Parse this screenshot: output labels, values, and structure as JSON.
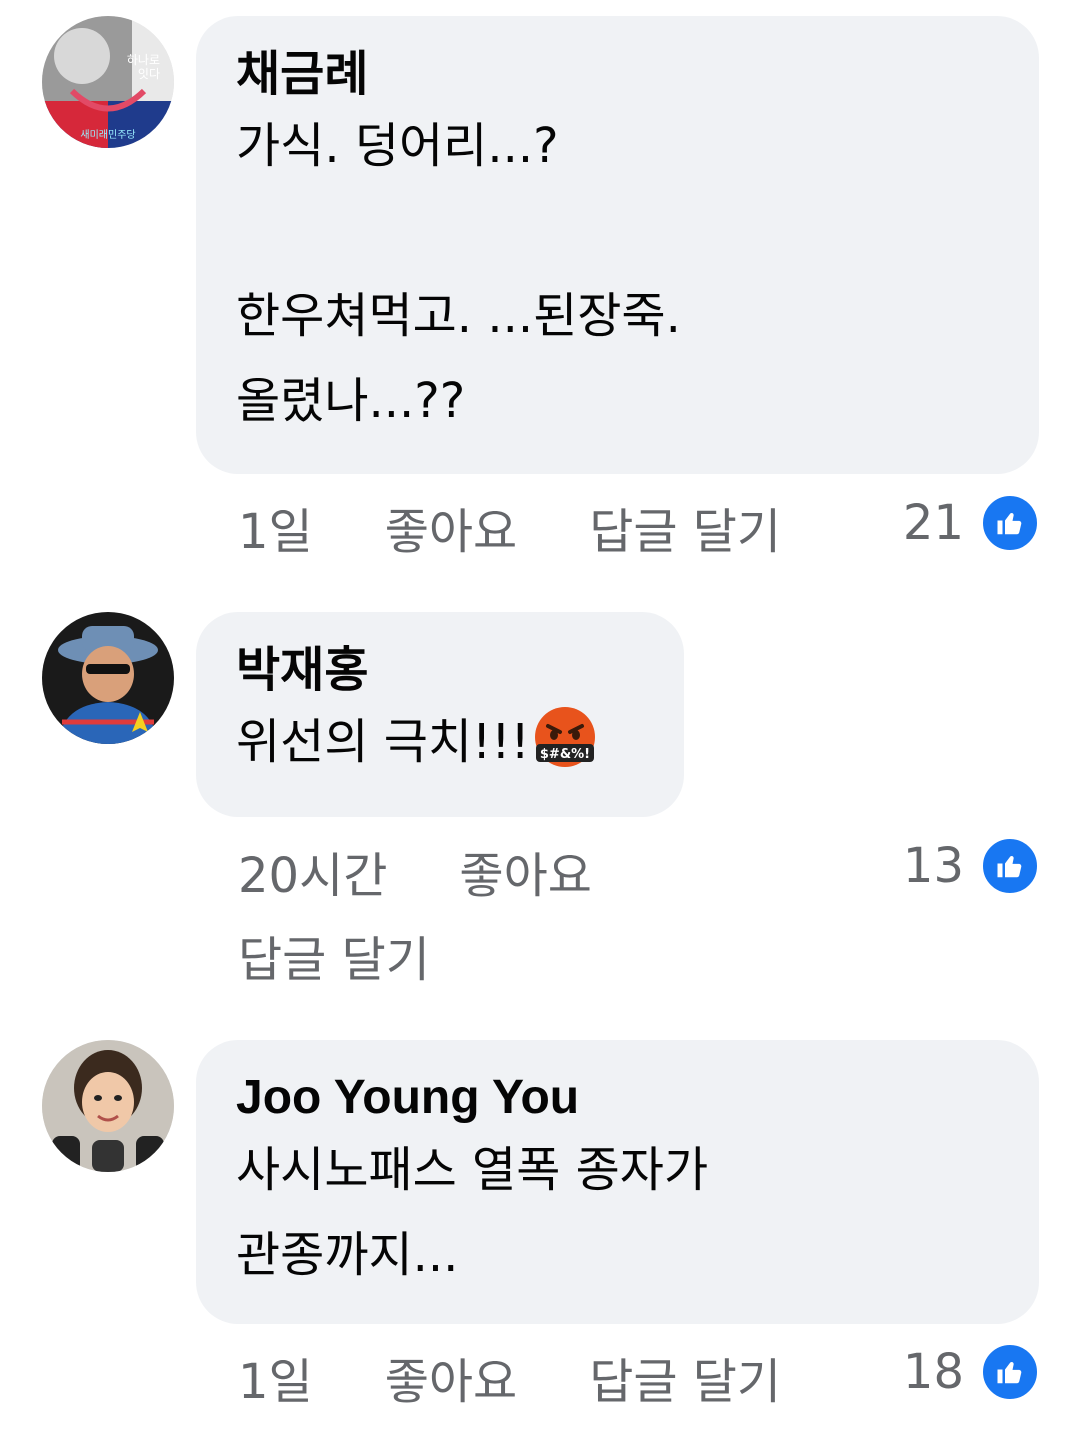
{
  "comments": [
    {
      "author": "채금례",
      "text": "가식. 덩어리...?\n\n한우쳐먹고.  ...된장죽.\n올렸나...??",
      "time": "1일",
      "like_label": "좋아요",
      "reply_label": "답글 달기",
      "reaction_count": "21",
      "avatar_caption_1": "하나로",
      "avatar_caption_2": "잇다",
      "avatar_caption_3": "새미래민주당"
    },
    {
      "author": "박재홍",
      "text": "위선의 극치!!!",
      "emoji_text": "$#&%!",
      "time": "20시간",
      "like_label": "좋아요",
      "reply_label": "답글 달기",
      "reaction_count": "13"
    },
    {
      "author": "Joo Young You",
      "text": "사시노패스 열폭 종자가\n관종까지...",
      "time": "1일",
      "like_label": "좋아요",
      "reply_label": "답글 달기",
      "reaction_count": "18"
    }
  ],
  "colors": {
    "bubble": "#f0f2f5",
    "meta_text": "#65676b",
    "like_blue": "#1877f2"
  },
  "icons": {
    "reaction": "thumbs-up-icon",
    "emoji": "face-with-symbols-on-mouth"
  }
}
